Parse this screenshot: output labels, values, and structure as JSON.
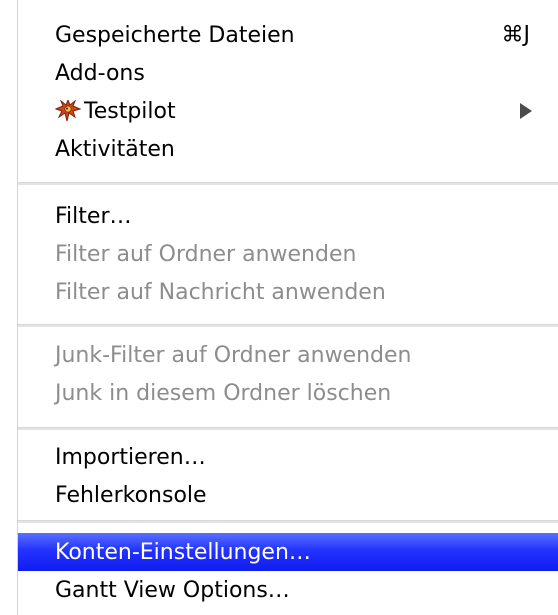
{
  "menu": {
    "items": [
      {
        "label": "Gespeicherte Dateien",
        "shortcut": "⌘J",
        "enabled": true
      },
      {
        "label": "Add-ons",
        "enabled": true
      },
      {
        "label": "Testpilot",
        "icon": "testpilot-icon",
        "submenu": true,
        "enabled": true
      },
      {
        "label": "Aktivitäten",
        "enabled": true
      },
      {
        "label": "Filter…",
        "enabled": true
      },
      {
        "label": "Filter auf Ordner anwenden",
        "enabled": false
      },
      {
        "label": "Filter auf Nachricht anwenden",
        "enabled": false
      },
      {
        "label": "Junk-Filter auf Ordner anwenden",
        "enabled": false
      },
      {
        "label": "Junk in diesem Ordner löschen",
        "enabled": false
      },
      {
        "label": "Importieren…",
        "enabled": true
      },
      {
        "label": "Fehlerkonsole",
        "enabled": true
      },
      {
        "label": "Konten-Einstellungen…",
        "enabled": true,
        "highlighted": true
      },
      {
        "label": "Gantt View Options…",
        "enabled": true
      }
    ]
  },
  "colors": {
    "highlight": "#1f2fff",
    "disabled_text": "#8d8d8d",
    "separator": "#e3e3e3"
  }
}
